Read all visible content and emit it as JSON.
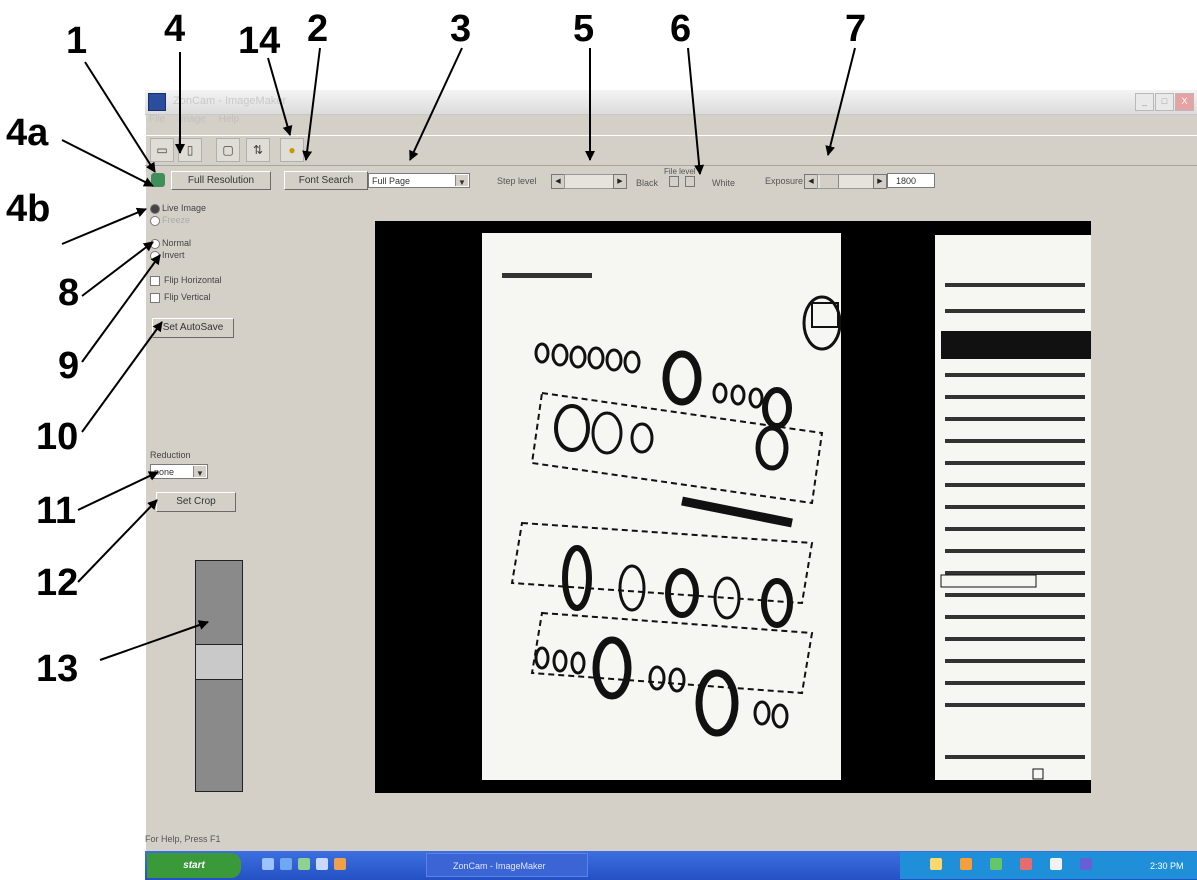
{
  "window": {
    "title": "ZonCam - ImageMaker",
    "menu": [
      "File",
      "Image",
      "Help"
    ],
    "controls": [
      "_",
      "□",
      "X"
    ]
  },
  "toolbar": {
    "buttons": [
      "save-icon",
      "scan-icon",
      "print-icon",
      "crop-icon",
      "bulb-icon"
    ]
  },
  "controls": {
    "full_resolution": "Full Resolution",
    "font_search": "Font Search",
    "mode_value": "Full Page",
    "step_label": "Step level",
    "black_label": "Black",
    "file_level_label": "File level",
    "white_label": "White",
    "exposure_label": "Exposure",
    "exposure_value": "1800"
  },
  "side_panel": {
    "live_image": "Live Image",
    "second_option": "Freeze",
    "normal": "Normal",
    "invert": "Invert",
    "flip_horizontal": "Flip Horizontal",
    "flip_vertical": "Flip Vertical",
    "set_autosave": "Set AutoSave",
    "reduction_label": "Reduction",
    "reduction_value": "none",
    "set_crop": "Set Crop"
  },
  "status": {
    "help": "For Help, Press F1"
  },
  "taskbar": {
    "start": "start",
    "task": "ZonCam - ImageMaker",
    "clock": "2:30 PM"
  },
  "callouts": [
    "1",
    "4",
    "14",
    "2",
    "3",
    "5",
    "6",
    "7",
    "4a",
    "4b",
    "8",
    "9",
    "10",
    "11",
    "12",
    "13"
  ]
}
